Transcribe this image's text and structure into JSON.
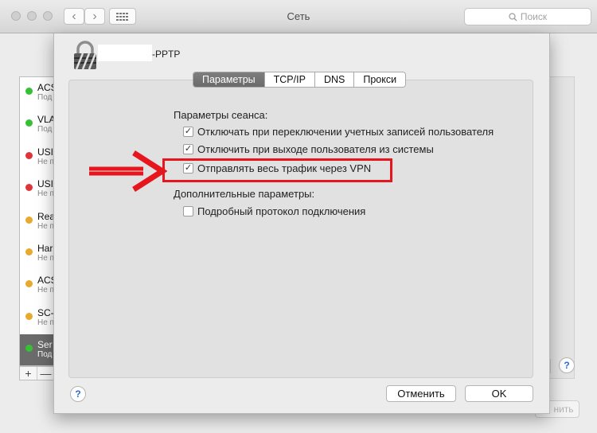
{
  "window": {
    "title": "Сеть",
    "search_placeholder": "Поиск"
  },
  "services": [
    {
      "name": "ACS",
      "status": "Под",
      "color": "#34c234"
    },
    {
      "name": "VLA",
      "status": "Под",
      "color": "#34c234"
    },
    {
      "name": "USI",
      "status": "Не п",
      "color": "#e0343a"
    },
    {
      "name": "USI",
      "status": "Не п",
      "color": "#e0343a"
    },
    {
      "name": "Rea",
      "status": "Не п",
      "color": "#e8a92e"
    },
    {
      "name": "Har",
      "status": "Не п",
      "color": "#e8a92e"
    },
    {
      "name": "ACS",
      "status": "Не п",
      "color": "#e8a92e"
    },
    {
      "name": "SC-",
      "status": "Не п",
      "color": "#e8a92e"
    },
    {
      "name": "Ser",
      "status": "Под",
      "color": "#34c234"
    }
  ],
  "list_tools": {
    "add": "+",
    "remove": "—"
  },
  "background": {
    "help": "?",
    "apply_label": "нить"
  },
  "sheet": {
    "vpn_name": "-PPTP",
    "tabs": [
      "Параметры",
      "TCP/IP",
      "DNS",
      "Прокси"
    ],
    "session_label": "Параметры сеанса:",
    "session_options": [
      {
        "label": "Отключать при переключении учетных записей пользователя",
        "checked": "✓"
      },
      {
        "label": "Отключить при выходе пользователя из системы",
        "checked": "✓"
      },
      {
        "label": "Отправлять весь трафик через VPN",
        "checked": "✓"
      }
    ],
    "advanced_label": "Дополнительные параметры:",
    "advanced_options": [
      {
        "label": "Подробный протокол подключения",
        "checked": ""
      }
    ],
    "help": "?",
    "cancel_label": "Отменить",
    "ok_label": "OK"
  },
  "colors": {
    "highlight": "#e5161d",
    "selected_row": "#6b6b6b"
  }
}
